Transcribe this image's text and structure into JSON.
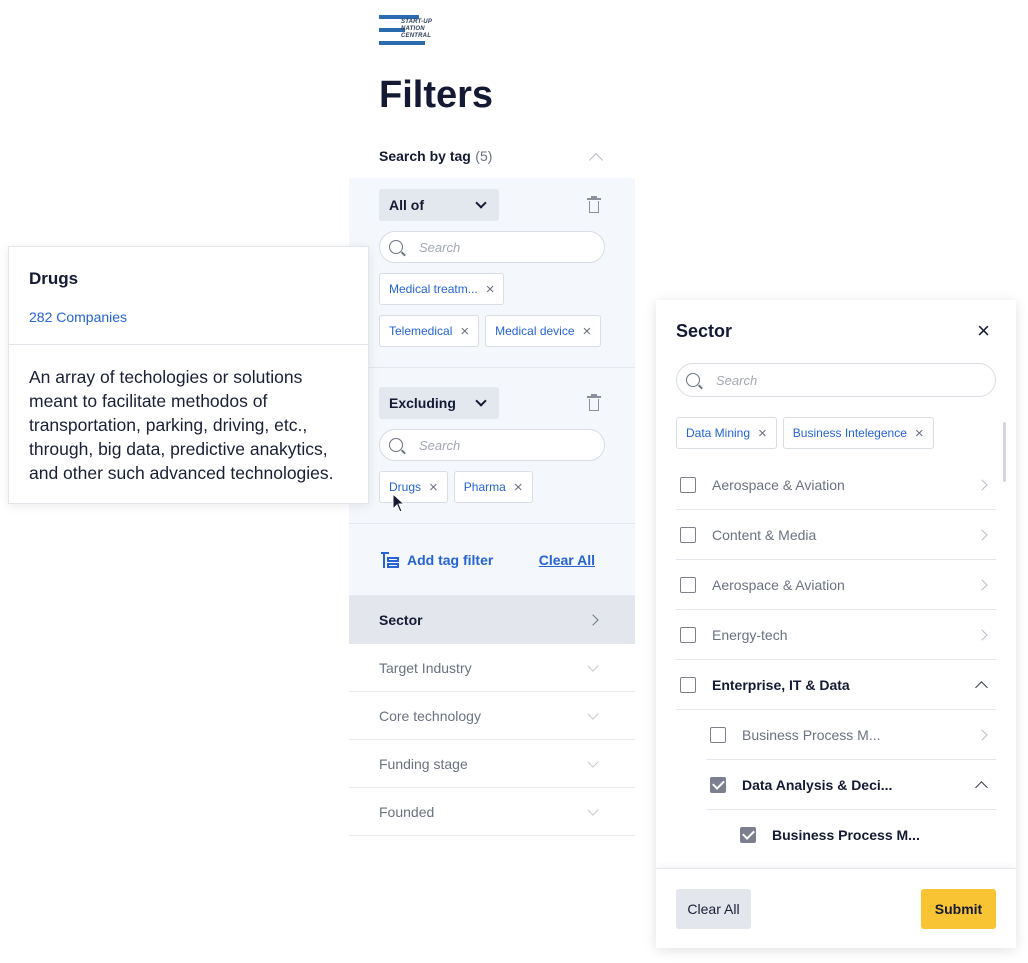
{
  "logo": {
    "text_line1": "START-UP",
    "text_line2": "NATION",
    "text_line3": "CENTRAL"
  },
  "page_title": "Filters",
  "search_by_tag": {
    "label": "Search by tag",
    "count": "(5)",
    "groups": [
      {
        "mode": "All of",
        "search_placeholder": "Search",
        "tags": [
          "Medical treatm...",
          "Telemedical",
          "Medical device"
        ]
      },
      {
        "mode": "Excluding",
        "search_placeholder": "Search",
        "tags": [
          "Drugs",
          "Pharma"
        ]
      }
    ],
    "add_tag_filter": "Add tag filter",
    "clear_all": "Clear All"
  },
  "accordion": [
    {
      "label": "Sector"
    },
    {
      "label": "Target Industry"
    },
    {
      "label": "Core technology"
    },
    {
      "label": "Funding stage"
    },
    {
      "label": "Founded"
    }
  ],
  "tooltip": {
    "title": "Drugs",
    "companies": "282 Companies",
    "description": "An array of techologies or solutions meant to facilitate methodos of transportation, parking, driving, etc., through, big data, predictive anakytics, and other such advanced technologies."
  },
  "sector_modal": {
    "title": "Sector",
    "search_placeholder": "Search",
    "selected_tags": [
      "Data Mining",
      "Business Intelegence"
    ],
    "items": [
      {
        "label": "Aerospace & Aviation",
        "checked": false
      },
      {
        "label": "Content & Media",
        "checked": false
      },
      {
        "label": "Aerospace & Aviation",
        "checked": false
      },
      {
        "label": "Energy-tech",
        "checked": false
      },
      {
        "label": "Enterprise, IT & Data",
        "checked": false
      },
      {
        "label": "Business Process M...",
        "checked": false
      },
      {
        "label": "Data Analysis & Deci...",
        "checked": true
      },
      {
        "label": "Business Process M...",
        "checked": true
      }
    ],
    "clear_all": "Clear All",
    "submit": "Submit"
  },
  "colors": {
    "accent_blue": "#2563d6",
    "submit_yellow": "#f8c433",
    "panel_bg": "#f4f7fb"
  }
}
